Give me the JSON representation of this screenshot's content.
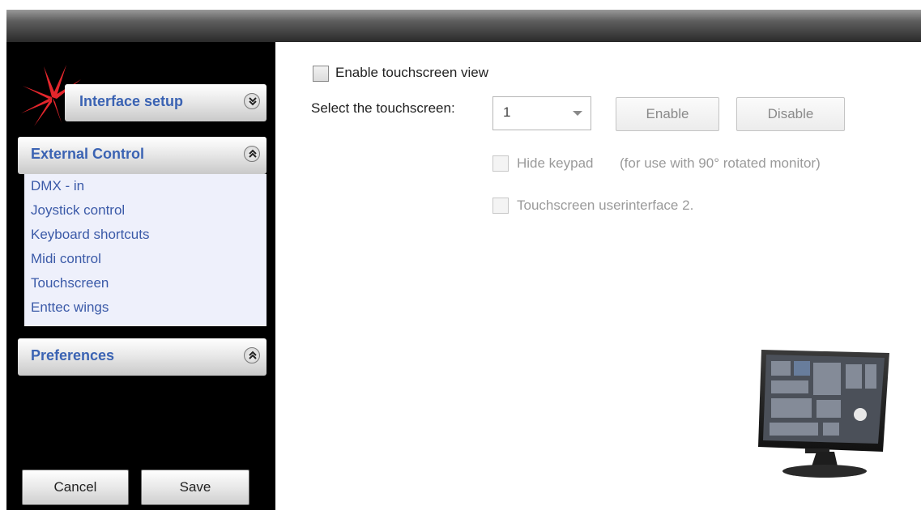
{
  "sidebar": {
    "interface_setup": {
      "title": "Interface setup"
    },
    "external_control": {
      "title": "External Control",
      "items": [
        {
          "label": "DMX - in"
        },
        {
          "label": "Joystick control"
        },
        {
          "label": "Keyboard shortcuts"
        },
        {
          "label": "Midi control"
        },
        {
          "label": "Touchscreen"
        },
        {
          "label": "Enttec wings"
        }
      ]
    },
    "preferences": {
      "title": "Preferences"
    }
  },
  "footer": {
    "cancel_label": "Cancel",
    "save_label": "Save"
  },
  "main": {
    "enable_touchscreen_label": "Enable touchscreen view",
    "enable_touchscreen_checked": false,
    "select_label": "Select the touchscreen:",
    "select_value": "1",
    "enable_button": "Enable",
    "disable_button": "Disable",
    "hide_keypad_label": "Hide keypad",
    "hide_keypad_note": "(for use with 90° rotated monitor)",
    "touch_ui2_label": "Touchscreen userinterface 2."
  },
  "colors": {
    "accent_text": "#3b63b3",
    "link_text": "#3b5aa8",
    "list_background": "#eef0fb",
    "sidebar_background": "#000000"
  },
  "icons": {
    "logo": "starburst-logo-icon",
    "collapse": "chevron-double-down-icon",
    "expand": "chevron-double-up-icon",
    "monitor": "touchscreen-monitor-icon"
  }
}
